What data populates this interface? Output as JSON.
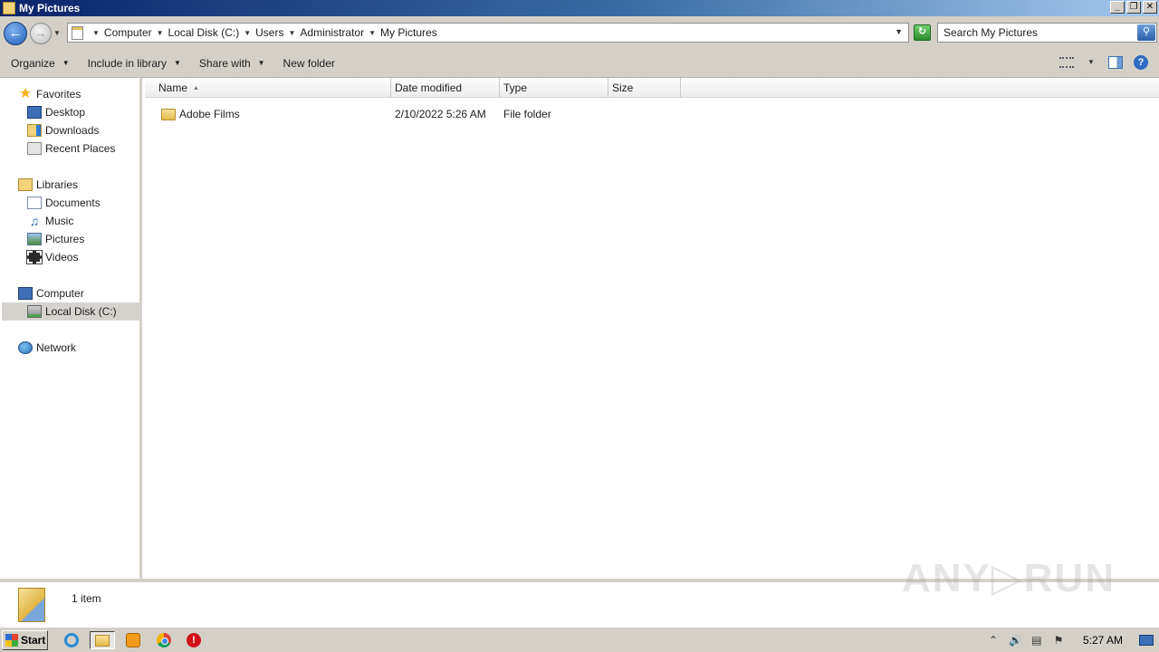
{
  "window": {
    "title": "My Pictures",
    "controls": {
      "minimize": "_",
      "restore": "❐",
      "close": "✕"
    }
  },
  "address_bar": {
    "breadcrumb": [
      "Computer",
      "Local Disk (C:)",
      "Users",
      "Administrator",
      "My Pictures"
    ],
    "search_placeholder": "Search My Pictures"
  },
  "toolbar": {
    "organize": "Organize",
    "include_in_library": "Include in library",
    "share_with": "Share with",
    "new_folder": "New folder"
  },
  "navigation": {
    "favorites": {
      "label": "Favorites",
      "items": [
        "Desktop",
        "Downloads",
        "Recent Places"
      ]
    },
    "libraries": {
      "label": "Libraries",
      "items": [
        "Documents",
        "Music",
        "Pictures",
        "Videos"
      ]
    },
    "computer": {
      "label": "Computer",
      "items": [
        "Local Disk (C:)"
      ]
    },
    "network": {
      "label": "Network"
    },
    "selected": "Local Disk (C:)"
  },
  "file_list": {
    "columns": [
      "Name",
      "Date modified",
      "Type",
      "Size"
    ],
    "sort_column": "Name",
    "rows": [
      {
        "name": "Adobe Films",
        "date_modified": "2/10/2022 5:26 AM",
        "type": "File folder",
        "size": ""
      }
    ]
  },
  "details_pane": {
    "item_count": "1 item"
  },
  "watermark": "ANY▷RUN",
  "taskbar": {
    "start_label": "Start",
    "apps": [
      "internet-explorer",
      "windows-explorer",
      "media-player",
      "chrome",
      "stop-sign"
    ],
    "active_app": "windows-explorer",
    "clock": "5:27 AM"
  }
}
